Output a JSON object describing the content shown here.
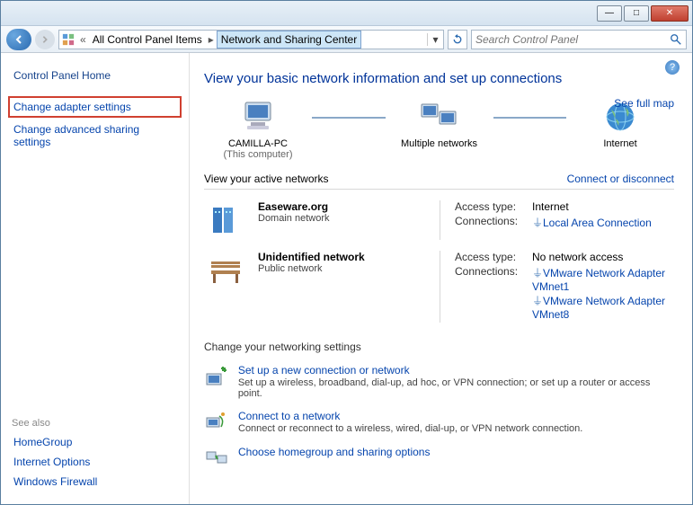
{
  "titlebar": {
    "min": "—",
    "max": "□",
    "close": "✕"
  },
  "nav": {
    "breadcrumb_prefix": "«",
    "breadcrumb1": "All Control Panel Items",
    "breadcrumb2": "Network and Sharing Center",
    "search_placeholder": "Search Control Panel"
  },
  "sidebar": {
    "home": "Control Panel Home",
    "change_adapter": "Change adapter settings",
    "change_advanced": "Change advanced sharing settings",
    "see_also": "See also",
    "homegroup": "HomeGroup",
    "internet_options": "Internet Options",
    "windows_firewall": "Windows Firewall"
  },
  "main": {
    "heading": "View your basic network information and set up connections",
    "full_map": "See full map",
    "topo": {
      "computer": "CAMILLA-PC",
      "computer_sub": "(This computer)",
      "multi": "Multiple networks",
      "internet": "Internet"
    },
    "active_hdr": "View your active networks",
    "connect_link": "Connect or disconnect",
    "networks": [
      {
        "name": "Easeware.org",
        "type": "Domain network",
        "access_label": "Access type:",
        "access_value": "Internet",
        "conn_label": "Connections:",
        "connections": [
          "Local Area Connection"
        ]
      },
      {
        "name": "Unidentified network",
        "type": "Public network",
        "access_label": "Access type:",
        "access_value": "No network access",
        "conn_label": "Connections:",
        "connections": [
          "VMware Network Adapter VMnet1",
          "VMware Network Adapter VMnet8"
        ]
      }
    ],
    "change_settings_hdr": "Change your networking settings",
    "tasks": [
      {
        "title": "Set up a new connection or network",
        "desc": "Set up a wireless, broadband, dial-up, ad hoc, or VPN connection; or set up a router or access point."
      },
      {
        "title": "Connect to a network",
        "desc": "Connect or reconnect to a wireless, wired, dial-up, or VPN network connection."
      },
      {
        "title": "Choose homegroup and sharing options",
        "desc": ""
      }
    ]
  }
}
